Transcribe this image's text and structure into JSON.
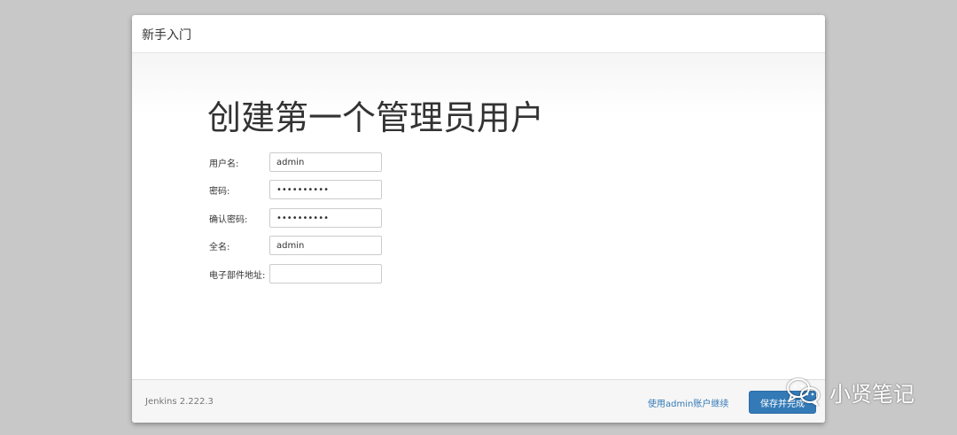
{
  "dialog": {
    "title": "新手入门"
  },
  "page_title": "创建第一个管理员用户",
  "form": {
    "fields": [
      {
        "label": "用户名:",
        "value": "admin"
      },
      {
        "label": "密码:",
        "value": "••••••••••"
      },
      {
        "label": "确认密码:",
        "value": "••••••••••"
      },
      {
        "label": "全名:",
        "value": "admin"
      },
      {
        "label": "电子部件地址:",
        "value": ""
      }
    ]
  },
  "footer": {
    "version": "Jenkins 2.222.3",
    "skip_link": "使用admin账户继续",
    "save_button": "保存并完成"
  },
  "watermark": {
    "text": "小贤笔记",
    "icon": "wechat-icon"
  },
  "colors": {
    "background": "#c8c8c8",
    "primary": "#337ab7",
    "link": "#337ab7"
  }
}
